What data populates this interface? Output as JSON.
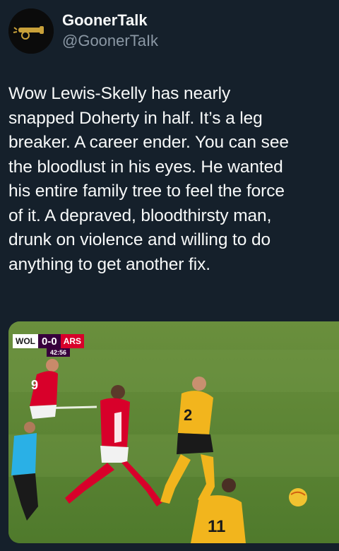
{
  "author": {
    "display_name": "GoonerTalk",
    "handle": "@GoonerTaIk",
    "avatar_icon": "cannon-icon"
  },
  "tweet": {
    "text": "Wow Lewis-Skelly has nearly\nsnapped Doherty in half. It’s a leg\nbreaker. A career ender. You can see\nthe bloodlust in his eyes. He wanted\nhis entire family tree to feel the force\nof it. A depraved, bloodthirsty man,\ndrunk on violence and willing to do\nanything to get another fix."
  },
  "media": {
    "scorebug": {
      "home": "WOL",
      "score": "0-0",
      "away": "ARS",
      "clock": "42:56"
    },
    "colors": {
      "pitch": "#5f8a35",
      "arsenal_red": "#d8002a",
      "wolves_gold": "#f2b51d",
      "pl_purple": "#37003c"
    }
  }
}
